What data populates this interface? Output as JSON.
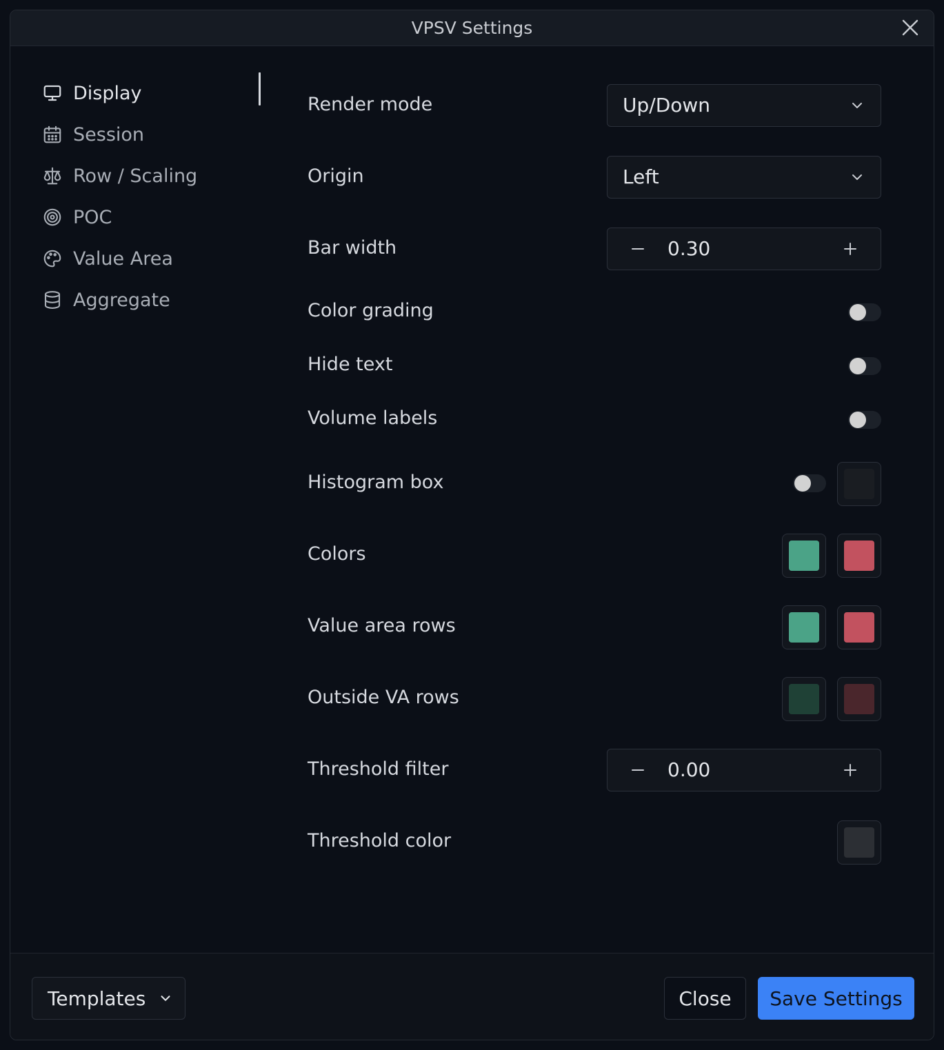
{
  "window": {
    "title": "VPSV Settings"
  },
  "sidebar": {
    "items": [
      {
        "label": "Display",
        "icon": "monitor-icon",
        "active": true
      },
      {
        "label": "Session",
        "icon": "calendar-icon"
      },
      {
        "label": "Row / Scaling",
        "icon": "scale-icon"
      },
      {
        "label": "POC",
        "icon": "target-icon"
      },
      {
        "label": "Value Area",
        "icon": "palette-icon"
      },
      {
        "label": "Aggregate",
        "icon": "database-icon"
      }
    ]
  },
  "settings": {
    "render_mode": {
      "label": "Render mode",
      "value": "Up/Down"
    },
    "origin": {
      "label": "Origin",
      "value": "Left"
    },
    "bar_width": {
      "label": "Bar width",
      "value": "0.30"
    },
    "color_grading": {
      "label": "Color grading",
      "enabled": false
    },
    "hide_text": {
      "label": "Hide text",
      "enabled": false
    },
    "volume_labels": {
      "label": "Volume labels",
      "enabled": false
    },
    "histogram_box": {
      "label": "Histogram box",
      "enabled": false,
      "color": "#1a1d22"
    },
    "colors": {
      "label": "Colors",
      "up": "#4ba387",
      "down": "#c2525f"
    },
    "value_area_rows": {
      "label": "Value area rows",
      "up": "#4ba387",
      "down": "#c2525f"
    },
    "outside_va_rows": {
      "label": "Outside VA rows",
      "up": "#1f4136",
      "down": "#4a262c"
    },
    "threshold_filter": {
      "label": "Threshold filter",
      "value": "0.00"
    },
    "threshold_color": {
      "label": "Threshold color",
      "color": "#2c2f34"
    }
  },
  "footer": {
    "templates_label": "Templates",
    "close_label": "Close",
    "save_label": "Save Settings"
  },
  "colors": {
    "accent": "#3b82f6",
    "background": "#0b0f17",
    "panel": "#161b23"
  }
}
